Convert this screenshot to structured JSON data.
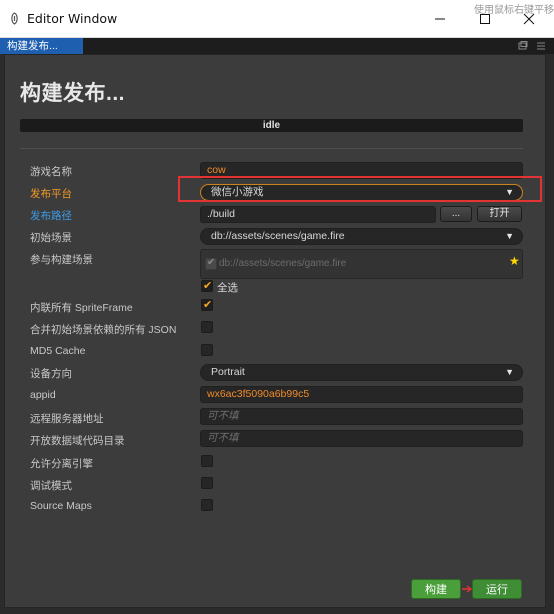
{
  "window": {
    "title": "Editor Window",
    "background_hint": "使用鼠标右键平移"
  },
  "tab": {
    "label": "构建发布..."
  },
  "page": {
    "title": "构建发布...",
    "status": "idle"
  },
  "form": {
    "game_name": {
      "label": "游戏名称",
      "value": "cow"
    },
    "platform": {
      "label": "发布平台",
      "value": "微信小游戏"
    },
    "build_path": {
      "label": "发布路径",
      "value": "./build",
      "browse_label": "...",
      "open_label": "打开"
    },
    "start_scene": {
      "label": "初始场景",
      "value": "db://assets/scenes/game.fire"
    },
    "scenes": {
      "label": "参与构建场景",
      "items": [
        "db://assets/scenes/game.fire"
      ],
      "select_all_label": "全选"
    },
    "inline_spriteframe": {
      "label": "内联所有 SpriteFrame",
      "checked": true
    },
    "merge_json": {
      "label": "合并初始场景依赖的所有 JSON",
      "checked": false
    },
    "md5": {
      "label": "MD5 Cache",
      "checked": false
    },
    "orientation": {
      "label": "设备方向",
      "value": "Portrait"
    },
    "appid": {
      "label": "appid",
      "value": "wx6ac3f5090a6b99c5"
    },
    "remote_server": {
      "label": "远程服务器地址",
      "placeholder": "可不填"
    },
    "open_data": {
      "label": "开放数据域代码目录",
      "placeholder": "可不填"
    },
    "separate_engine": {
      "label": "允许分离引擎",
      "checked": false
    },
    "debug": {
      "label": "调试模式",
      "checked": false
    },
    "source_maps": {
      "label": "Source Maps",
      "checked": false
    }
  },
  "actions": {
    "build_label": "构建",
    "run_label": "运行"
  },
  "colors": {
    "accent": "#f59a23",
    "link": "#3d9be9",
    "primary_button": "#4a9f3b",
    "highlight": "#e33333"
  },
  "icons": [
    "app-icon",
    "minimize-icon",
    "maximize-icon",
    "close-icon",
    "layout-icon",
    "menu-icon",
    "dropdown-arrow-icon",
    "star-icon",
    "checkmark-icon"
  ]
}
